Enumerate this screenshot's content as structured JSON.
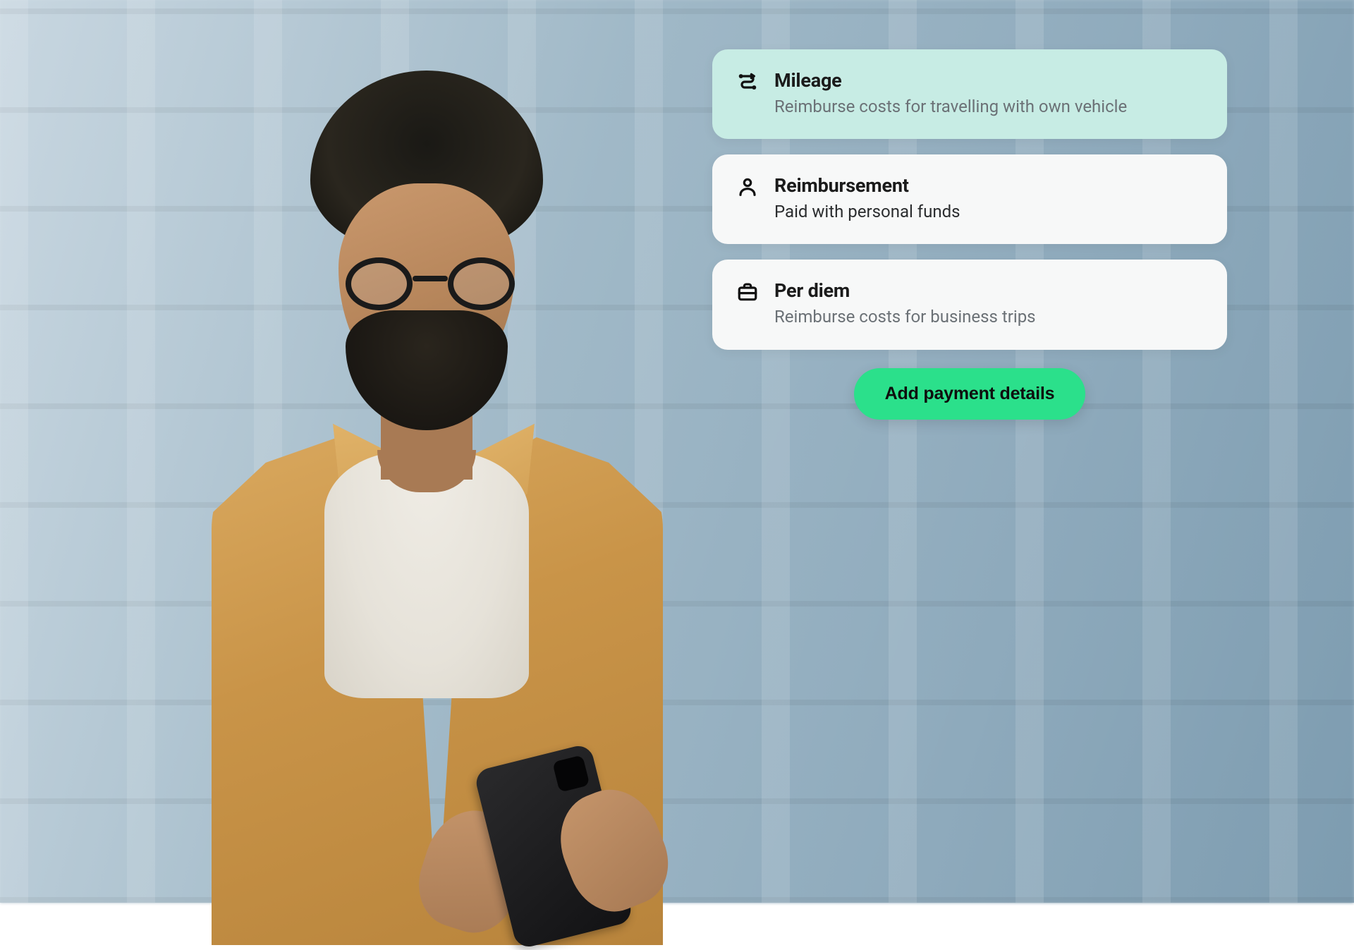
{
  "options": [
    {
      "icon": "route-icon",
      "title": "Mileage",
      "description": "Reimburse costs for travelling with own vehicle",
      "selected": true
    },
    {
      "icon": "person-icon",
      "title": "Reimbursement",
      "description": "Paid with personal funds",
      "selected": false
    },
    {
      "icon": "briefcase-icon",
      "title": "Per diem",
      "description": "Reimburse costs for business trips",
      "selected": false
    }
  ],
  "cta": {
    "label": "Add payment details"
  },
  "colors": {
    "selected_bg": "#c7ece4",
    "card_bg": "#f7f8f8",
    "cta_bg": "#2be08b",
    "title": "#1b1b1b",
    "muted": "#6b7176"
  }
}
